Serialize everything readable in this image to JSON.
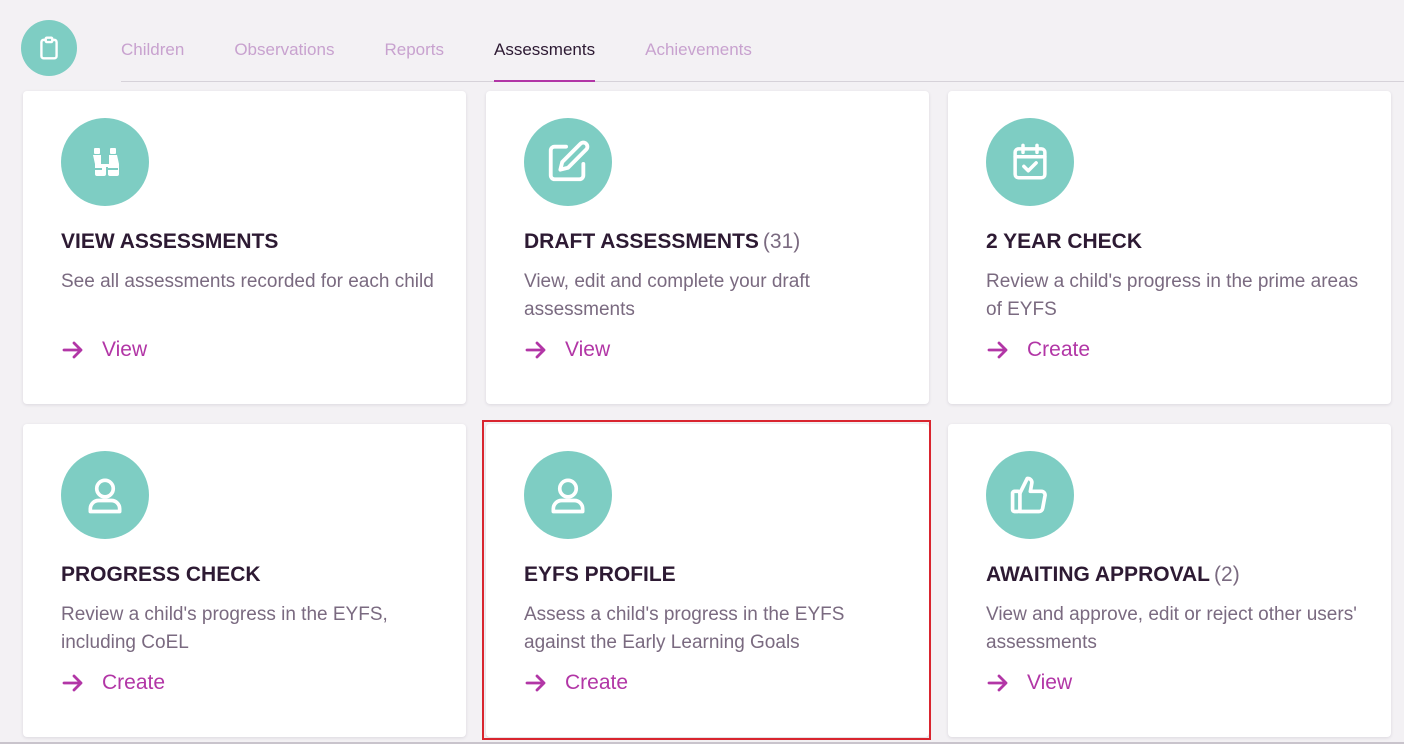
{
  "header": {
    "app_icon": "clipboard-icon",
    "tabs": [
      {
        "label": "Children",
        "active": false
      },
      {
        "label": "Observations",
        "active": false
      },
      {
        "label": "Reports",
        "active": false
      },
      {
        "label": "Assessments",
        "active": true
      },
      {
        "label": "Achievements",
        "active": false
      }
    ]
  },
  "colors": {
    "accent": "#b236a6",
    "icon_teal": "#7ecdc3",
    "title_dark": "#2d1a33",
    "text_muted": "#7a6a80",
    "tab_inactive": "#c8a2cf",
    "highlight_border": "#d9252f"
  },
  "cards": [
    {
      "icon": "binoculars-icon",
      "title": "VIEW ASSESSMENTS",
      "count": "",
      "description": "See all assessments recorded for each child",
      "action": "View"
    },
    {
      "icon": "edit-square-icon",
      "title": "DRAFT ASSESSMENTS",
      "count": "(31)",
      "description": "View, edit and complete your draft assessments",
      "action": "View"
    },
    {
      "icon": "calendar-check-icon",
      "title": "2 YEAR CHECK",
      "count": "",
      "description": "Review a child's progress in the prime areas of EYFS",
      "action": "Create"
    },
    {
      "icon": "user-icon",
      "title": "PROGRESS CHECK",
      "count": "",
      "description": "Review a child's progress in the EYFS, including CoEL",
      "action": "Create"
    },
    {
      "icon": "user-icon",
      "title": "EYFS PROFILE",
      "count": "",
      "description": "Assess a child's progress in the EYFS against the Early Learning Goals",
      "action": "Create"
    },
    {
      "icon": "thumbs-up-icon",
      "title": "AWAITING APPROVAL",
      "count": "(2)",
      "description": "View and approve, edit or reject other users' assessments",
      "action": "View"
    }
  ]
}
